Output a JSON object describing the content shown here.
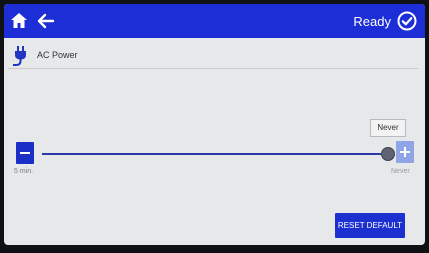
{
  "header": {
    "status_text": "Ready",
    "bar_color": "#1d2ed6",
    "icons": [
      "home-icon",
      "back-arrow-icon",
      "check-circle-icon"
    ]
  },
  "subheader": {
    "title": "AC Power",
    "icon": "power-plug-icon"
  },
  "slider": {
    "min_label": "5 min.",
    "max_label": "Never",
    "current_value": "Never",
    "level": 1.0,
    "minus_icon": "minus-icon",
    "plus_icon": "plus-icon"
  },
  "footer": {
    "reset_label": "RESET DEFAULT"
  }
}
